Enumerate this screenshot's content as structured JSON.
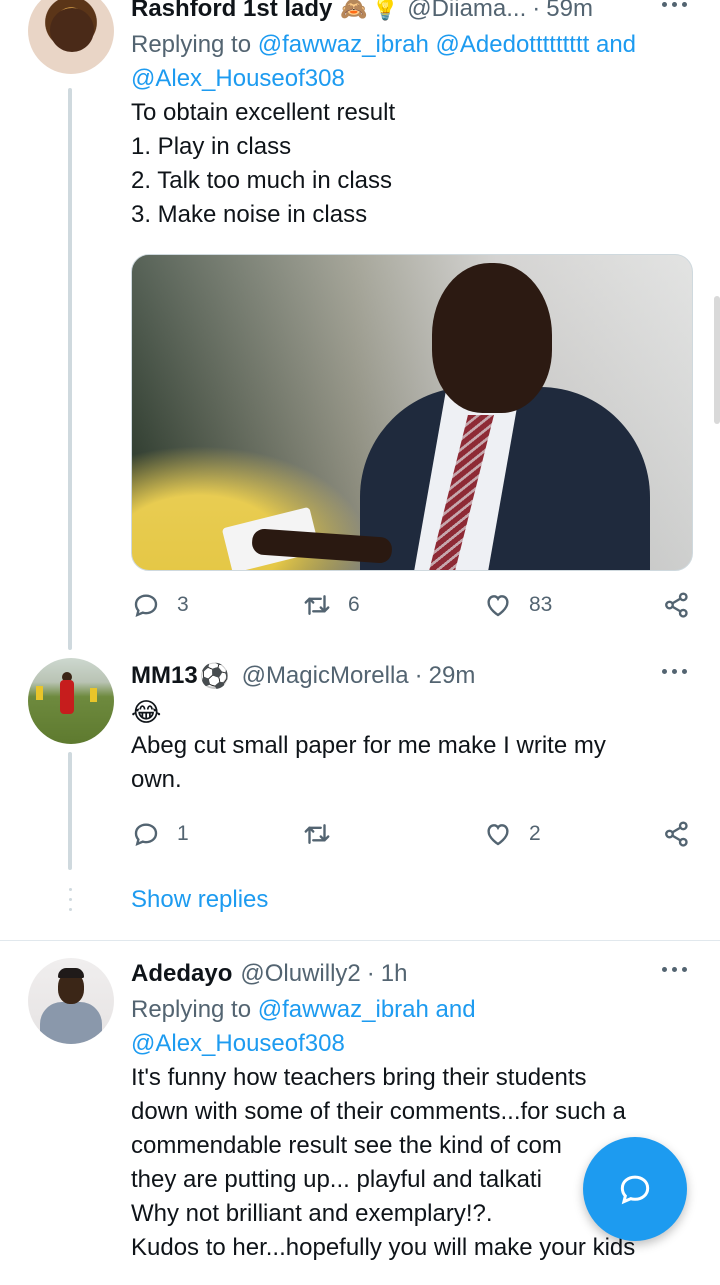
{
  "tweets": [
    {
      "name": "Rashford 1st lady",
      "name_emojis": [
        "🙈",
        "💡"
      ],
      "handle": "@Diiama...",
      "time": "59m",
      "replying_prefix": "Replying to",
      "replying_mentions": "@fawwaz_ibrah @Adedottttttttt",
      "replying_and": "and",
      "replying_last": "@Alex_Houseof308",
      "lines": [
        "To obtain excellent result",
        "1. Play in class",
        "2. Talk too much in class",
        "3. Make noise in class"
      ],
      "replies": "3",
      "retweets": "6",
      "likes": "83"
    },
    {
      "name": "MM13",
      "name_emoji": "⚽",
      "handle": "@MagicMorella",
      "time": "29m",
      "emoji_line": "😂",
      "lines": [
        "Abeg cut small paper for me make I write my",
        "own."
      ],
      "replies": "1",
      "retweets": "",
      "likes": "2"
    },
    {
      "name": "Adedayo",
      "handle": "@Oluwilly2",
      "time": "1h",
      "replying_prefix": "Replying to",
      "replying_mentions": "@fawwaz_ibrah",
      "replying_and": "and",
      "replying_last": "@Alex_Houseof308",
      "lines": [
        "It's funny how teachers bring their students",
        "down with some of their comments...for such a",
        "commendable result see the kind of com",
        "they are putting up... playful and talkati",
        "Why not brilliant and exemplary!?.",
        "Kudos to her...hopefully you will make your kids"
      ]
    }
  ],
  "show_replies": "Show replies",
  "separator_dot": "·",
  "colors": {
    "accent": "#1d9bf0",
    "muted": "#536471",
    "text": "#0f1419",
    "line": "#cfd9de"
  },
  "icons": [
    "reply-icon",
    "retweet-icon",
    "like-icon",
    "share-icon",
    "more-icon",
    "compose-icon"
  ]
}
